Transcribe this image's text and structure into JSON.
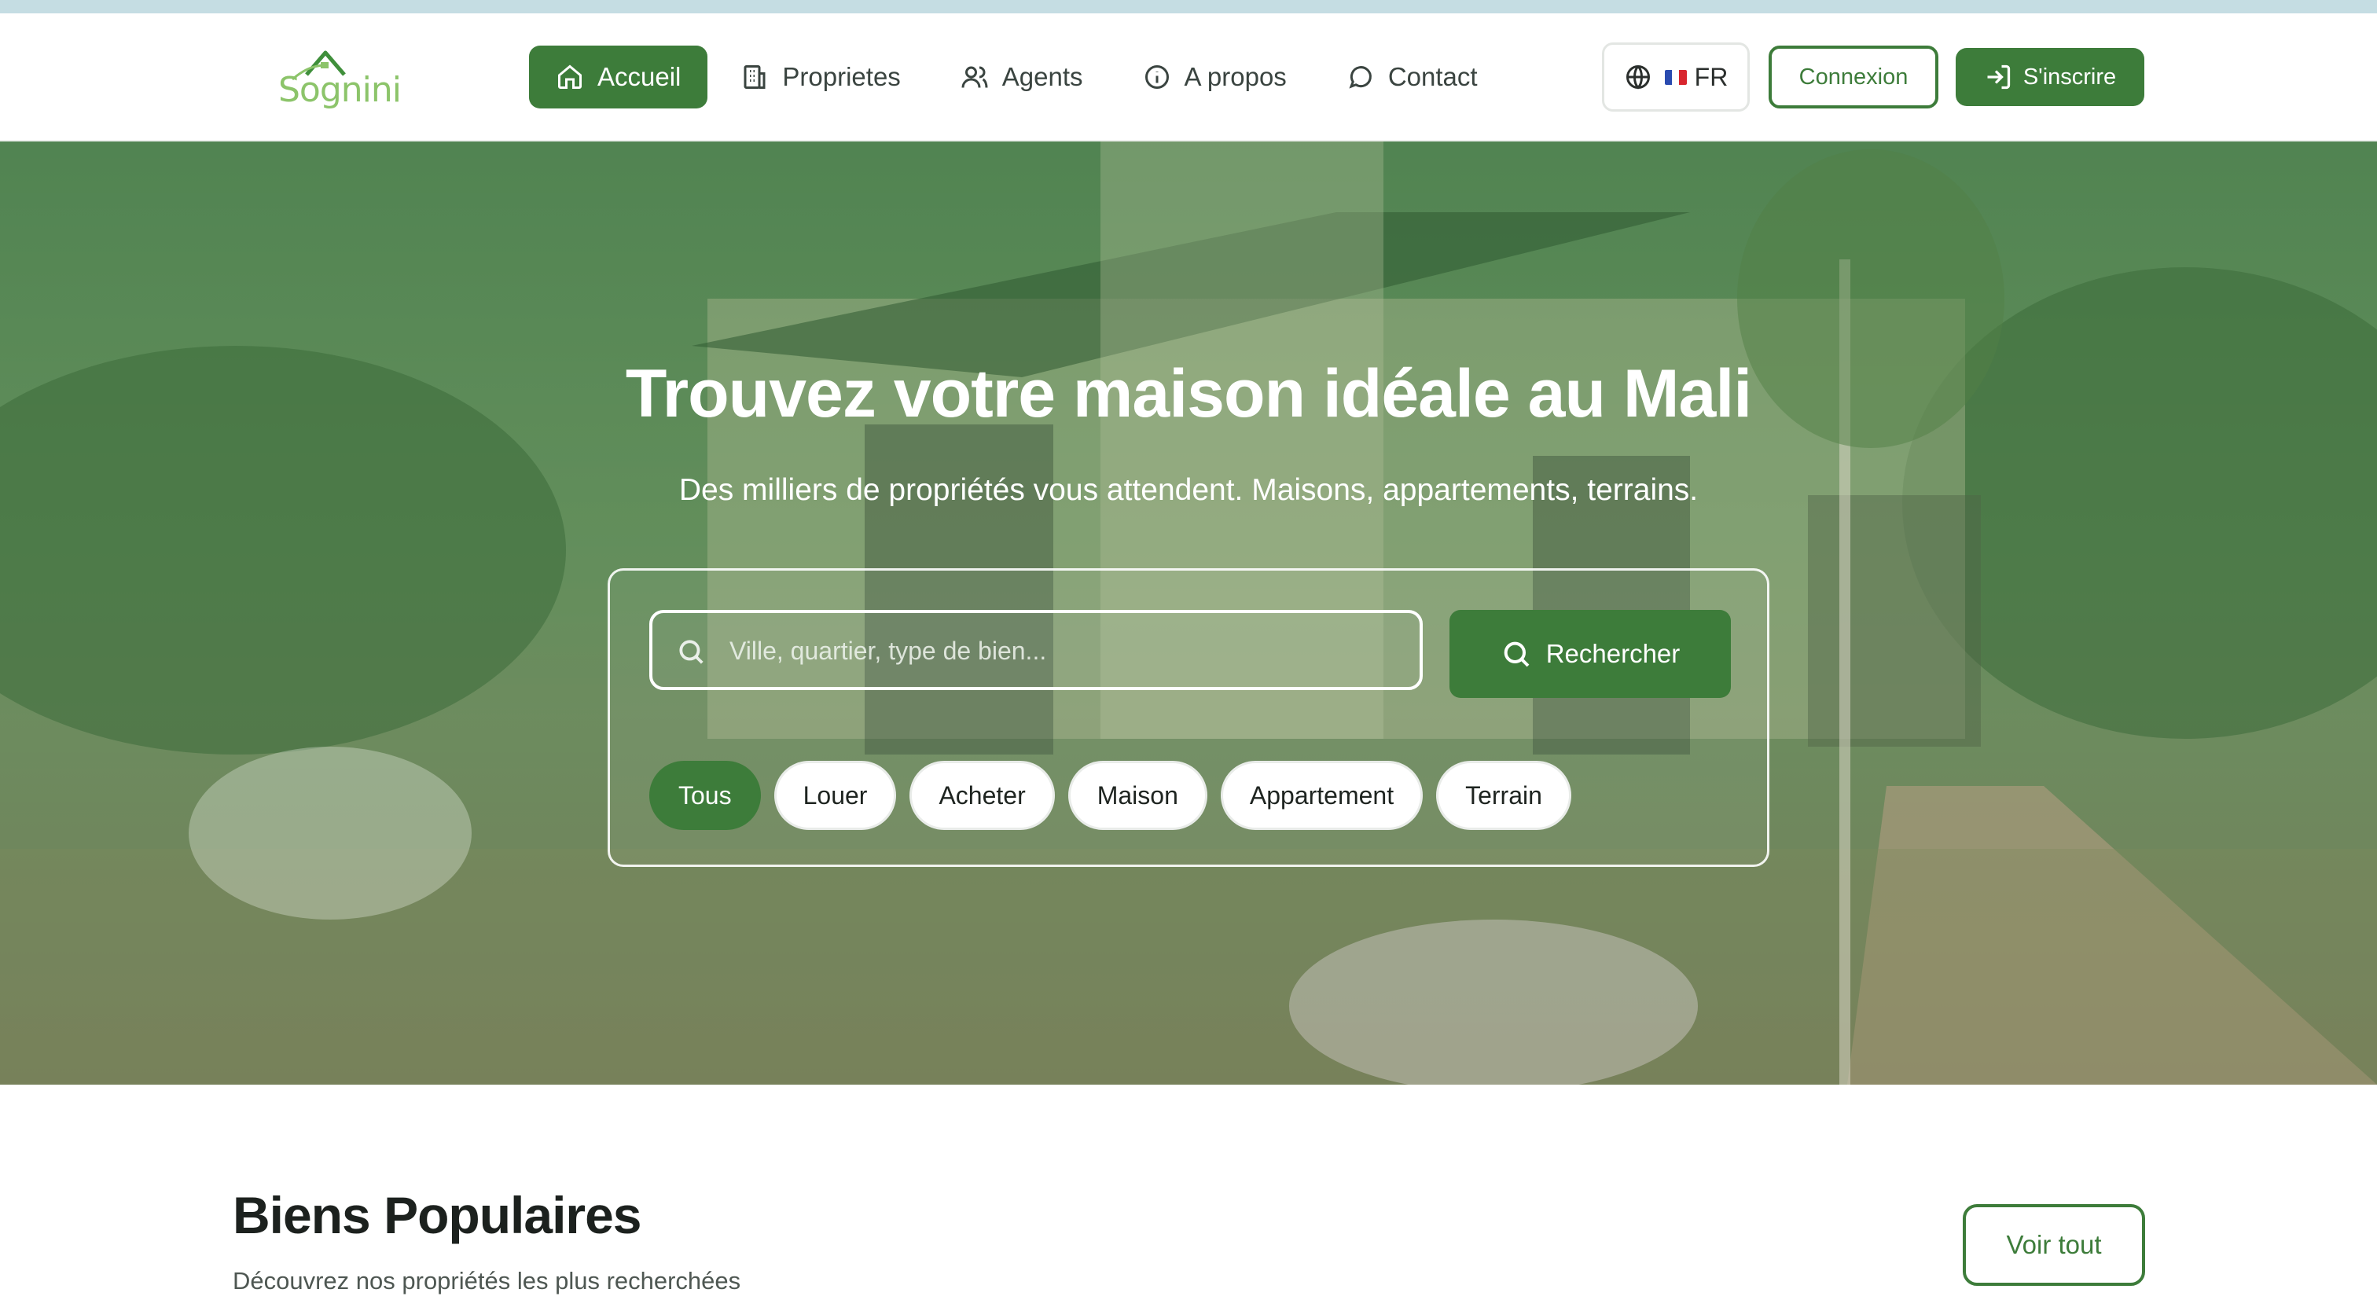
{
  "brand": {
    "name": "Sognini",
    "colors": {
      "primary": "#3d7c3a",
      "accent": "#8cc46a"
    }
  },
  "nav": {
    "items": [
      {
        "label": "Accueil",
        "icon": "home-icon",
        "active": true
      },
      {
        "label": "Proprietes",
        "icon": "building-icon",
        "active": false
      },
      {
        "label": "Agents",
        "icon": "users-icon",
        "active": false
      },
      {
        "label": "A propos",
        "icon": "info-icon",
        "active": false
      },
      {
        "label": "Contact",
        "icon": "chat-icon",
        "active": false
      }
    ]
  },
  "header": {
    "language": {
      "code": "FR",
      "icon": "globe-icon",
      "flag": "france-flag-icon"
    },
    "login_label": "Connexion",
    "signup_label": "S'inscrire",
    "signup_icon": "login-arrow-icon"
  },
  "hero": {
    "title": "Trouvez votre maison idéale au Mali",
    "subtitle": "Des milliers de propriétés vous attendent. Maisons, appartements, terrains.",
    "search": {
      "placeholder": "Ville, quartier, type de bien...",
      "value": "",
      "button_label": "Rechercher",
      "icon": "search-icon"
    },
    "filters": [
      {
        "label": "Tous",
        "active": true
      },
      {
        "label": "Louer",
        "active": false
      },
      {
        "label": "Acheter",
        "active": false
      },
      {
        "label": "Maison",
        "active": false
      },
      {
        "label": "Appartement",
        "active": false
      },
      {
        "label": "Terrain",
        "active": false
      }
    ]
  },
  "popular": {
    "title": "Biens Populaires",
    "subtitle": "Découvrez nos propriétés les plus recherchées",
    "view_all_label": "Voir tout"
  }
}
